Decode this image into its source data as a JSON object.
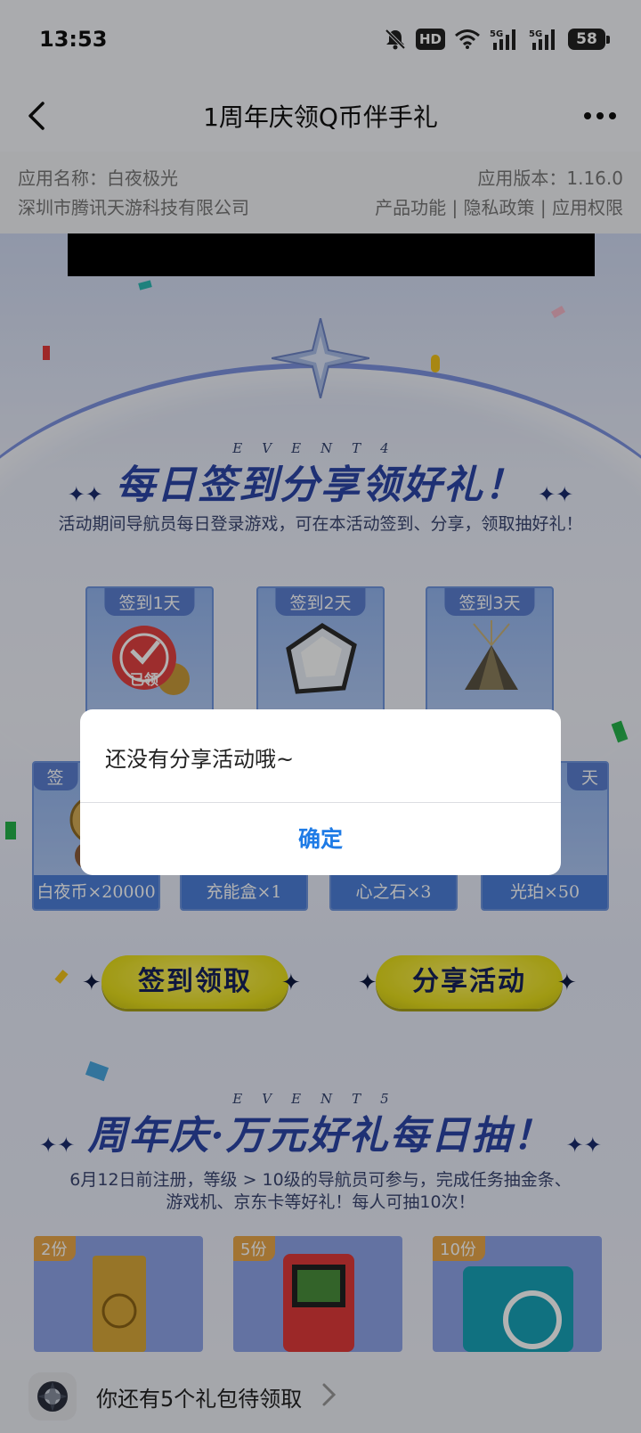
{
  "status": {
    "time": "13:53",
    "hd_badge": "HD",
    "signal1_label": "5G",
    "signal2_label": "5G",
    "battery": "58"
  },
  "nav": {
    "title": "1周年庆领Q币伴手礼"
  },
  "app_info": {
    "app_name": "应用名称：白夜极光",
    "app_version": "应用版本：1.16.0",
    "company": "深圳市腾讯天游科技有限公司",
    "links": "产品功能 | 隐私政策 | 应用权限"
  },
  "event4": {
    "event_label": "EVENT4",
    "title": "每日签到分享领好礼！",
    "description": "活动期间导航员每日登录游戏，可在本活动签到、分享，领取抽好礼！",
    "day_cards": [
      {
        "tag": "签到1天",
        "stamp": "已领"
      },
      {
        "tag": "签到2天"
      },
      {
        "tag": "签到3天"
      }
    ],
    "reward_cards": [
      {
        "tag": "签",
        "label": "白夜币×20000"
      },
      {
        "tag": "",
        "label": "充能盒×1"
      },
      {
        "tag": "",
        "label": "心之石×3"
      },
      {
        "tag": "天",
        "label": "光珀×50"
      }
    ],
    "checkin_button": "签到领取",
    "share_button": "分享活动"
  },
  "event5": {
    "event_label": "EVENT5",
    "title": "周年庆·万元好礼每日抽！",
    "description_line1": "6月12日前注册，等级 > 10级的导航员可参与，完成任务抽金条、",
    "description_line2": "游戏机、京东卡等好礼！每人可抽10次！",
    "prizes": [
      {
        "tag": "2份"
      },
      {
        "tag": "5份"
      },
      {
        "tag": "10份"
      }
    ]
  },
  "bottom_bar": {
    "text": "你还有5个礼包待领取"
  },
  "dialog": {
    "message": "还没有分享活动哦~",
    "confirm": "确定"
  },
  "colors": {
    "accent": "#1e7be6",
    "title_blue": "#2b45a6",
    "button_yellow": "#e6dd1c"
  }
}
